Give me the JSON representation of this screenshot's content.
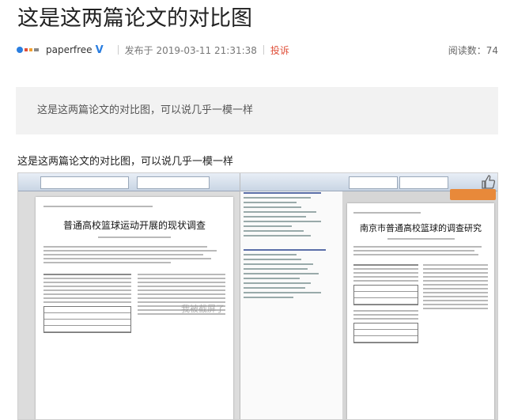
{
  "article": {
    "title": "这是这两篇论文的对比图",
    "author": "paperfree",
    "published_label": "发布于 2019-03-11 21:31:38",
    "report_label": "投诉",
    "read_count_label": "阅读数：74",
    "summary": "这是这两篇论文的对比图，可以说几乎一模一样",
    "body": "这是这两篇论文的对比图，可以说几乎一模一样"
  },
  "screenshot": {
    "left_doc_title": "普通高校篮球运动开展的现状调查",
    "right_doc_title": "南京市普通高校篮球的调查研究",
    "watermark": "我被截屏了"
  },
  "colors": {
    "verify": "#2a7ee0",
    "report": "#e0503a",
    "summary_bg": "#f2f2f2"
  },
  "icons": [
    "paperfree-logo-icon",
    "verified-v-icon",
    "thumbs-up-icon"
  ]
}
